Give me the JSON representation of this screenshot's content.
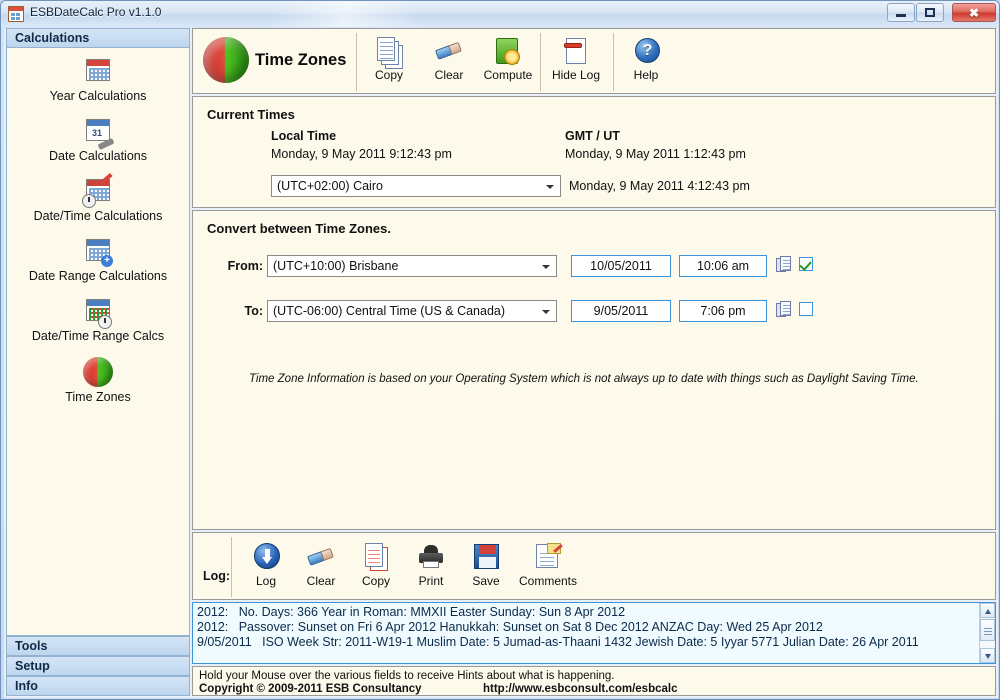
{
  "window": {
    "title": "ESBDateCalc Pro v1.1.0",
    "icon": "app-calendar-icon",
    "buttons": {
      "minimize": "–",
      "maximize": "□",
      "close": "✖"
    }
  },
  "sidebar": {
    "categories": [
      {
        "label": "Calculations",
        "position": "top"
      },
      {
        "label": "Tools",
        "position": "bottom"
      },
      {
        "label": "Setup",
        "position": "bottom"
      },
      {
        "label": "Info",
        "position": "bottom"
      }
    ],
    "items": [
      {
        "label": "Year Calculations",
        "icon": "calendar-red-icon"
      },
      {
        "label": "Date Calculations",
        "icon": "calendar-wrench-icon"
      },
      {
        "label": "Date/Time Calculations",
        "icon": "calendar-clock-pencil-icon"
      },
      {
        "label": "Date Range Calculations",
        "icon": "calendar-plus-icon"
      },
      {
        "label": "Date/Time Range Calcs",
        "icon": "calendar-range-clock-icon"
      },
      {
        "label": "Time Zones",
        "icon": "globe-icon"
      }
    ]
  },
  "toolbar": {
    "page_icon": "globe-icon",
    "page_title": "Time Zones",
    "buttons": [
      {
        "label": "Copy",
        "icon": "copy-pages-icon"
      },
      {
        "label": "Clear",
        "icon": "eraser-icon"
      },
      {
        "label": "Compute",
        "icon": "book-gear-icon"
      },
      {
        "label": "Hide Log",
        "icon": "page-minus-icon"
      },
      {
        "label": "Help",
        "icon": "help-question-icon"
      }
    ]
  },
  "current_times": {
    "group_title": "Current Times",
    "local_label": "Local Time",
    "local_value": "Monday, 9 May 2011 9:12:43 pm",
    "gmt_label": "GMT / UT",
    "gmt_value": "Monday, 9 May 2011 1:12:43 pm",
    "timezone_combo": "(UTC+02:00) Cairo",
    "timezone_value": "Monday, 9 May 2011 4:12:43 pm"
  },
  "convert": {
    "group_title": "Convert between Time Zones.",
    "from": {
      "label": "From:",
      "zone": "(UTC+10:00) Brisbane",
      "date": "10/05/2011",
      "time": "10:06 am",
      "copy_icon": "copy-icon",
      "checked": true
    },
    "to": {
      "label": "To:",
      "zone": "(UTC-06:00) Central Time (US & Canada)",
      "date": "9/05/2011",
      "time": "7:06 pm",
      "copy_icon": "copy-icon",
      "checked": false
    },
    "note": "Time Zone Information is based on your Operating System which is not always up to date with things such as Daylight Saving Time."
  },
  "log_toolbar": {
    "label": "Log:",
    "buttons": [
      {
        "label": "Log",
        "icon": "download-arrow-icon"
      },
      {
        "label": "Clear",
        "icon": "eraser-icon"
      },
      {
        "label": "Copy",
        "icon": "copy-page-red-icon"
      },
      {
        "label": "Print",
        "icon": "printer-icon"
      },
      {
        "label": "Save",
        "icon": "floppy-disk-icon"
      },
      {
        "label": "Comments",
        "icon": "comments-note-icon"
      }
    ]
  },
  "log": {
    "text": "2012:   No. Days: 366 Year in Roman: MMXII Easter Sunday: Sun 8 Apr 2012\n2012:   Passover: Sunset on Fri 6 Apr 2012 Hanukkah: Sunset on Sat 8 Dec 2012 ANZAC Day: Wed 25 Apr 2012\n9/05/2011   ISO Week Str: 2011-W19-1 Muslim Date: 5 Jumad-as-Thaani 1432 Jewish Date: 5 Iyyar 5771 Julian Date: 26 Apr 2011"
  },
  "status": {
    "hint": "Hold your Mouse over the various fields to receive Hints about what is happening.",
    "copyright": "Copyright © 2009-2011 ESB Consultancy",
    "url": "http://www.esbconsult.com/esbcalc"
  },
  "colors": {
    "panel_bg": "#fdfaec",
    "accent_border": "#3c93d8",
    "title_bar": "#cfdff2",
    "category_header": "#c9ddf2",
    "log_bg": "#f0fbff"
  }
}
